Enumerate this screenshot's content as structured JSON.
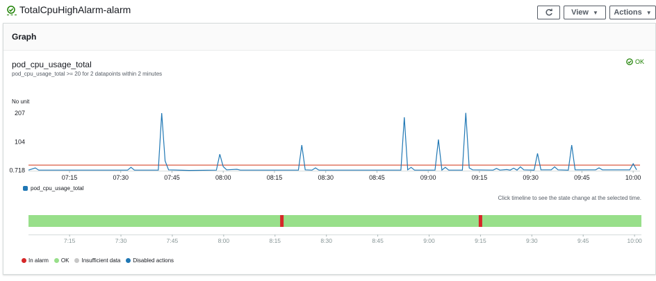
{
  "header": {
    "alarm_name": "TotalCpuHighAlarm-alarm",
    "view_label": "View",
    "actions_label": "Actions"
  },
  "panel": {
    "title": "Graph",
    "metric_name": "pod_cpu_usage_total",
    "condition": "pod_cpu_usage_total >= 20 for 2 datapoints within 2 minutes",
    "status": "OK",
    "unit": "No unit",
    "timeline_hint": "Click timeline to see the state change at the selected time."
  },
  "colors": {
    "series": "#1f77b4",
    "threshold": "#d13212",
    "ok": "#98df8a",
    "alarm": "#d62728",
    "insufficient": "#c7c7c7",
    "disabled": "#1f77b4"
  },
  "chart_data": {
    "type": "line",
    "ylabel": "No unit",
    "ytick_labels": [
      "207",
      "104",
      "0.718"
    ],
    "y_ticks": [
      207,
      104,
      0.718
    ],
    "ylim": [
      0,
      207
    ],
    "xtick_labels": [
      "07:15",
      "07:30",
      "07:45",
      "08:00",
      "08:15",
      "08:30",
      "08:45",
      "09:00",
      "09:15",
      "09:30",
      "09:45",
      "10:00"
    ],
    "x_start": "07:03",
    "x_end": "10:02",
    "threshold": 20,
    "series": [
      {
        "name": "pod_cpu_usage_total",
        "points": [
          [
            "07:03",
            2
          ],
          [
            "07:05",
            10
          ],
          [
            "07:06",
            2
          ],
          [
            "07:32",
            2
          ],
          [
            "07:33",
            12
          ],
          [
            "07:34",
            2
          ],
          [
            "07:41",
            2
          ],
          [
            "07:42",
            207
          ],
          [
            "07:43",
            35
          ],
          [
            "07:44",
            3
          ],
          [
            "07:50",
            1
          ],
          [
            "07:58",
            2
          ],
          [
            "07:59",
            59
          ],
          [
            "08:00",
            15
          ],
          [
            "08:01",
            3
          ],
          [
            "08:04",
            5
          ],
          [
            "08:05",
            2
          ],
          [
            "08:22",
            2
          ],
          [
            "08:23",
            92
          ],
          [
            "08:24",
            3
          ],
          [
            "08:26",
            2
          ],
          [
            "08:27",
            10
          ],
          [
            "08:28",
            2
          ],
          [
            "08:52",
            2
          ],
          [
            "08:53",
            192
          ],
          [
            "08:54",
            3
          ],
          [
            "08:55",
            12
          ],
          [
            "08:56",
            2
          ],
          [
            "09:02",
            2
          ],
          [
            "09:03",
            112
          ],
          [
            "09:04",
            2
          ],
          [
            "09:05",
            12
          ],
          [
            "09:06",
            2
          ],
          [
            "09:10",
            2
          ],
          [
            "09:11",
            208
          ],
          [
            "09:12",
            10
          ],
          [
            "09:13",
            3
          ],
          [
            "09:19",
            2
          ],
          [
            "09:20",
            8
          ],
          [
            "09:21",
            2
          ],
          [
            "09:23",
            4
          ],
          [
            "09:24",
            2
          ],
          [
            "09:25",
            9
          ],
          [
            "09:26",
            2
          ],
          [
            "09:27",
            14
          ],
          [
            "09:28",
            3
          ],
          [
            "09:31",
            2
          ],
          [
            "09:32",
            62
          ],
          [
            "09:33",
            3
          ],
          [
            "09:36",
            3
          ],
          [
            "09:37",
            14
          ],
          [
            "09:38",
            3
          ],
          [
            "09:41",
            2
          ],
          [
            "09:42",
            92
          ],
          [
            "09:43",
            3
          ],
          [
            "09:49",
            3
          ],
          [
            "09:50",
            10
          ],
          [
            "09:51",
            3
          ],
          [
            "09:59",
            3
          ],
          [
            "10:00",
            25
          ],
          [
            "10:01",
            3
          ]
        ]
      }
    ],
    "legend": [
      "pod_cpu_usage_total"
    ],
    "timeline": {
      "tick_labels": [
        "7:15",
        "7:30",
        "7:45",
        "8:00",
        "8:15",
        "8:30",
        "8:45",
        "9:00",
        "9:15",
        "9:30",
        "9:45",
        "10:00"
      ],
      "alarm_times": [
        "08:17",
        "09:15"
      ],
      "legend": [
        "In alarm",
        "OK",
        "Insufficient data",
        "Disabled actions"
      ]
    }
  }
}
